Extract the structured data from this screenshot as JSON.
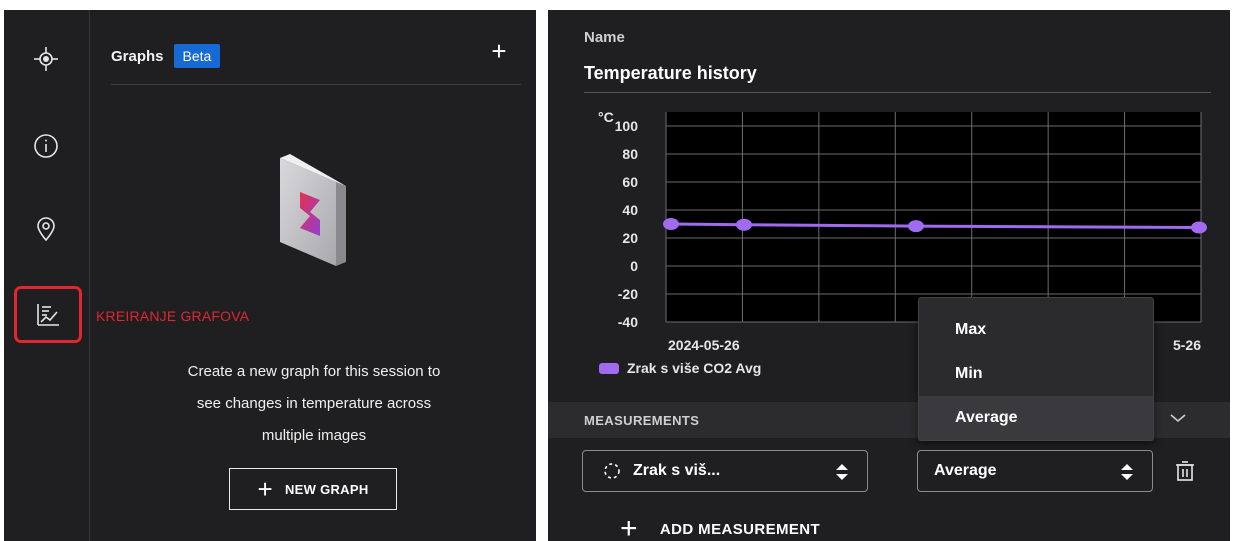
{
  "left_panel": {
    "rail": [
      {
        "icon": "crosshair-icon"
      },
      {
        "icon": "info-icon"
      },
      {
        "icon": "location-pin-icon"
      },
      {
        "icon": "graph-icon",
        "active": true
      }
    ],
    "annotation": "KREIRANJE GRAFOVA",
    "header": {
      "title": "Graphs",
      "badge": "Beta",
      "add_icon": "+"
    },
    "empty_state": {
      "line1": "Create a new graph for this session to",
      "line2": "see changes in temperature across",
      "line3": "multiple images",
      "button_icon": "+",
      "button_label": "NEW GRAPH"
    }
  },
  "right_panel": {
    "name_label": "Name",
    "name_value": "Temperature history",
    "measurements_label": "MEASUREMENTS",
    "zone_select_value": "Zrak s viš...",
    "stat_select_value": "Average",
    "dropdown": {
      "options": [
        "Max",
        "Min",
        "Average"
      ],
      "selected": "Average"
    },
    "add_icon": "+",
    "add_measurement_label": "ADD MEASUREMENT"
  },
  "chart_data": {
    "type": "line",
    "unit_label": "°C",
    "y_ticks": [
      100,
      80,
      60,
      40,
      20,
      0,
      -20,
      -40
    ],
    "ylim": [
      -40,
      110
    ],
    "x_tick_labels": [
      {
        "text": "2024-05-26",
        "pos": "left"
      },
      {
        "text": "5-26",
        "pos": "right"
      }
    ],
    "grid": true,
    "series": [
      {
        "name": "Zrak s više CO2 Avg",
        "color": "#a06bf0",
        "values": [
          30,
          29.5,
          28.5,
          27.5
        ]
      }
    ],
    "legend_position": "bottom-left"
  },
  "colors": {
    "panel_bg": "#1f1f21",
    "accent_blue": "#1769d6",
    "annotation_red": "#e0262e",
    "series_purple": "#a06bf0"
  }
}
